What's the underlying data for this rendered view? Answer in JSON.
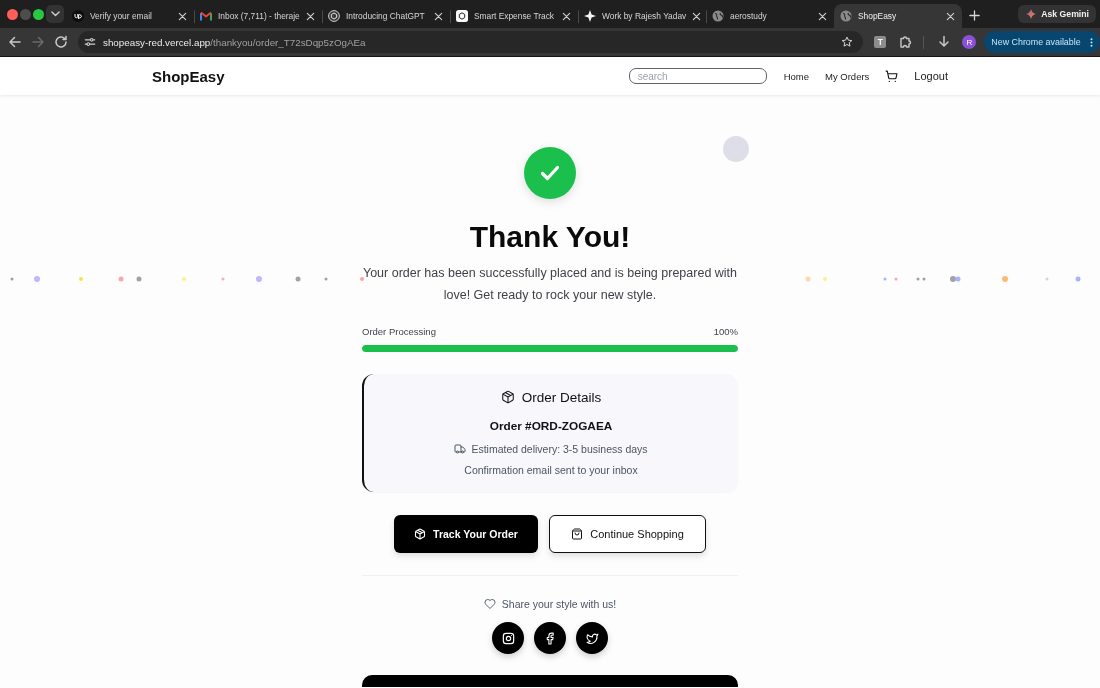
{
  "browser": {
    "tabs": [
      {
        "title": "Verify your email",
        "kind": "logo",
        "selected": false
      },
      {
        "title": "Inbox (7,711) - theraje",
        "kind": "mail",
        "selected": false
      },
      {
        "title": "Introducing ChatGPT",
        "kind": "knot",
        "selected": false
      },
      {
        "title": "Smart Expense Track",
        "kind": "tile",
        "selected": false
      },
      {
        "title": "Work by Rajesh Yadav",
        "kind": "star",
        "selected": false
      },
      {
        "title": "aerostudy",
        "kind": "globe",
        "selected": false
      },
      {
        "title": "ShopEasy",
        "kind": "globe",
        "selected": true
      }
    ],
    "gemini_button": "Ask Gemini",
    "forward_disabled": true,
    "url_host": "shopeasy-red.vercel.app",
    "url_path": "/thankyou/order_T72sDqp5zOgAEa",
    "extension_letter": "T",
    "profile_initial": "R",
    "update_button": "New Chrome available"
  },
  "site": {
    "brand": "ShopEasy",
    "search": {
      "placeholder": "search"
    },
    "nav_links": [
      "Home",
      "My Orders"
    ],
    "logout": "Logout"
  },
  "order": {
    "title": "Thank You!",
    "message": "Your order has been successfully placed and is being prepared with love! Get ready to rock your new style.",
    "progress": {
      "label": "Order Processing",
      "reading": "100%",
      "level": 1
    },
    "details": {
      "heading": "Order Details",
      "order_number": "Order #ORD-ZOGAEA",
      "delivery": "Estimated delivery: 3-5 business days",
      "email_note": "Confirmation email sent to your inbox"
    },
    "actions": [
      {
        "label": "Track Your Order",
        "kind": "primary"
      },
      {
        "label": "Continue Shopping",
        "kind": "secondary"
      }
    ],
    "share": {
      "text": "Share your style with us!",
      "socials": [
        {
          "kind": "instagram"
        },
        {
          "kind": "facebook"
        },
        {
          "kind": "twitter"
        }
      ]
    }
  }
}
